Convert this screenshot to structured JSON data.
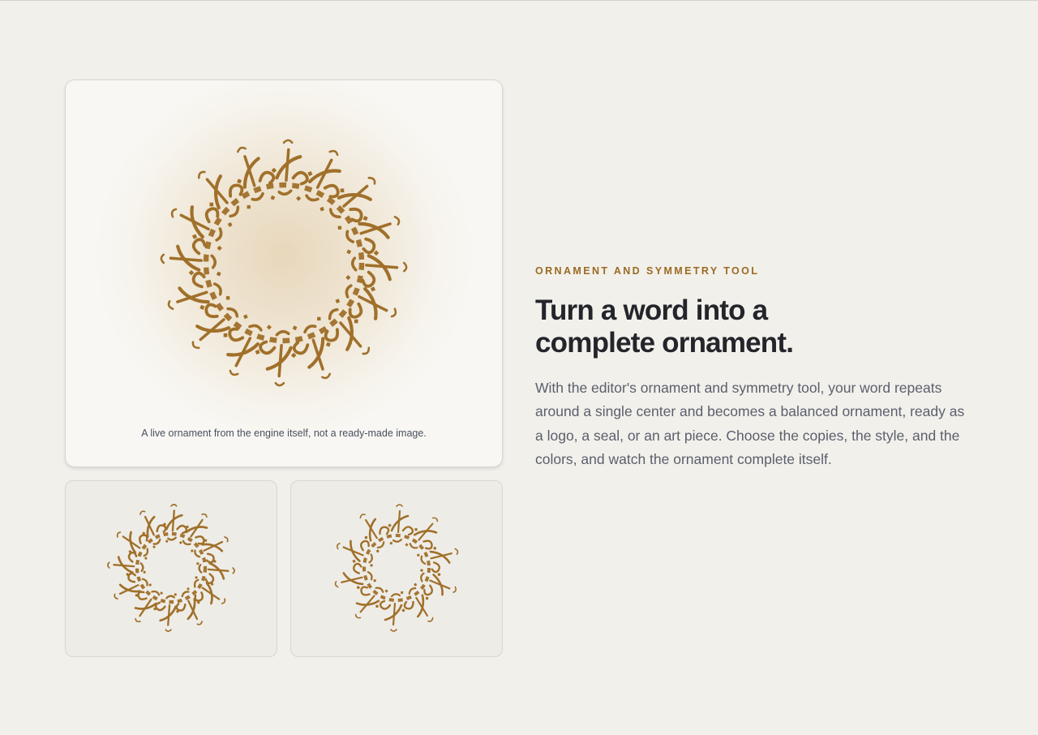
{
  "hero": {
    "caption": "A live ornament from the engine itself, not a ready-made image."
  },
  "feature": {
    "eyebrow": "ORNAMENT AND SYMMETRY TOOL",
    "headline_line1": "Turn a word into a",
    "headline_line2": "complete ornament.",
    "description": "With the editor's ornament and symmetry tool, your word repeats around a single center and becomes a balanced ornament, ready as a logo, a seal, or an art piece. Choose the copies, the style, and the colors, and watch the ornament complete itself."
  },
  "colors": {
    "ornament": "#a0702a",
    "accent": "#9b6a22",
    "background": "#f2f0eb"
  }
}
